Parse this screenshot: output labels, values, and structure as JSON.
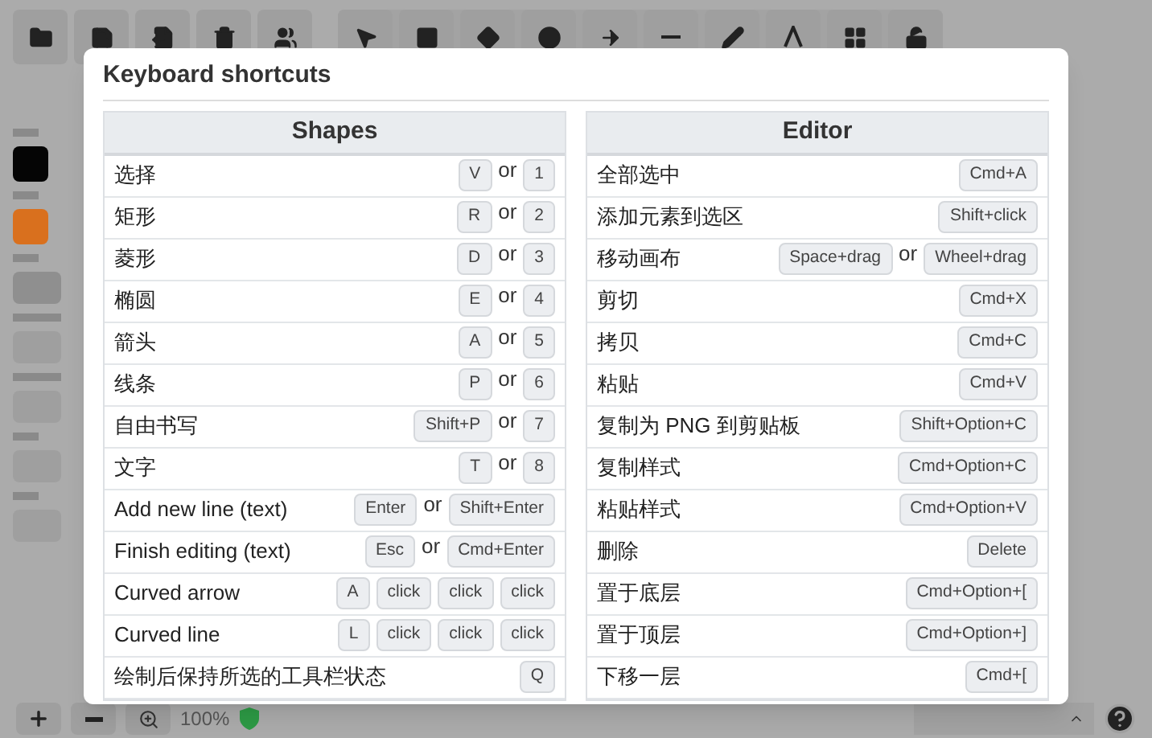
{
  "dialog": {
    "title": "Keyboard shortcuts"
  },
  "sections": [
    {
      "title": "Shapes",
      "rows": [
        {
          "label": "选择",
          "keys": [
            {
              "kind": "key",
              "text": "V"
            },
            {
              "kind": "or",
              "text": "or"
            },
            {
              "kind": "key",
              "text": "1"
            }
          ]
        },
        {
          "label": "矩形",
          "keys": [
            {
              "kind": "key",
              "text": "R"
            },
            {
              "kind": "or",
              "text": "or"
            },
            {
              "kind": "key",
              "text": "2"
            }
          ]
        },
        {
          "label": "菱形",
          "keys": [
            {
              "kind": "key",
              "text": "D"
            },
            {
              "kind": "or",
              "text": "or"
            },
            {
              "kind": "key",
              "text": "3"
            }
          ]
        },
        {
          "label": "椭圆",
          "keys": [
            {
              "kind": "key",
              "text": "E"
            },
            {
              "kind": "or",
              "text": "or"
            },
            {
              "kind": "key",
              "text": "4"
            }
          ]
        },
        {
          "label": "箭头",
          "keys": [
            {
              "kind": "key",
              "text": "A"
            },
            {
              "kind": "or",
              "text": "or"
            },
            {
              "kind": "key",
              "text": "5"
            }
          ]
        },
        {
          "label": "线条",
          "keys": [
            {
              "kind": "key",
              "text": "P"
            },
            {
              "kind": "or",
              "text": "or"
            },
            {
              "kind": "key",
              "text": "6"
            }
          ]
        },
        {
          "label": "自由书写",
          "keys": [
            {
              "kind": "key",
              "text": "Shift+P"
            },
            {
              "kind": "or",
              "text": "or"
            },
            {
              "kind": "key",
              "text": "7"
            }
          ]
        },
        {
          "label": "文字",
          "keys": [
            {
              "kind": "key",
              "text": "T"
            },
            {
              "kind": "or",
              "text": "or"
            },
            {
              "kind": "key",
              "text": "8"
            }
          ]
        },
        {
          "label": "Add new line (text)",
          "keys": [
            {
              "kind": "key",
              "text": "Enter"
            },
            {
              "kind": "or",
              "text": "or"
            },
            {
              "kind": "key",
              "text": "Shift+Enter"
            }
          ]
        },
        {
          "label": "Finish editing (text)",
          "keys": [
            {
              "kind": "key",
              "text": "Esc"
            },
            {
              "kind": "or",
              "text": "or"
            },
            {
              "kind": "key",
              "text": "Cmd+Enter"
            }
          ]
        },
        {
          "label": "Curved arrow",
          "keys": [
            {
              "kind": "key",
              "text": "A"
            },
            {
              "kind": "key",
              "text": "click"
            },
            {
              "kind": "key",
              "text": "click"
            },
            {
              "kind": "key",
              "text": "click"
            }
          ]
        },
        {
          "label": "Curved line",
          "keys": [
            {
              "kind": "key",
              "text": "L"
            },
            {
              "kind": "key",
              "text": "click"
            },
            {
              "kind": "key",
              "text": "click"
            },
            {
              "kind": "key",
              "text": "click"
            }
          ]
        },
        {
          "label": "绘制后保持所选的工具栏状态",
          "keys": [
            {
              "kind": "key",
              "text": "Q"
            }
          ]
        }
      ]
    },
    {
      "title": "Editor",
      "rows": [
        {
          "label": "全部选中",
          "keys": [
            {
              "kind": "key",
              "text": "Cmd+A"
            }
          ]
        },
        {
          "label": "添加元素到选区",
          "keys": [
            {
              "kind": "key",
              "text": "Shift+click"
            }
          ]
        },
        {
          "label": "移动画布",
          "keys": [
            {
              "kind": "key",
              "text": "Space+drag"
            },
            {
              "kind": "or",
              "text": "or"
            },
            {
              "kind": "key",
              "text": "Wheel+drag"
            }
          ]
        },
        {
          "label": "剪切",
          "keys": [
            {
              "kind": "key",
              "text": "Cmd+X"
            }
          ]
        },
        {
          "label": "拷贝",
          "keys": [
            {
              "kind": "key",
              "text": "Cmd+C"
            }
          ]
        },
        {
          "label": "粘贴",
          "keys": [
            {
              "kind": "key",
              "text": "Cmd+V"
            }
          ]
        },
        {
          "label": "复制为 PNG 到剪贴板",
          "keys": [
            {
              "kind": "key",
              "text": "Shift+Option+C"
            }
          ]
        },
        {
          "label": "复制样式",
          "keys": [
            {
              "kind": "key",
              "text": "Cmd+Option+C"
            }
          ]
        },
        {
          "label": "粘贴样式",
          "keys": [
            {
              "kind": "key",
              "text": "Cmd+Option+V"
            }
          ]
        },
        {
          "label": "删除",
          "keys": [
            {
              "kind": "key",
              "text": "Delete"
            }
          ]
        },
        {
          "label": "置于底层",
          "keys": [
            {
              "kind": "key",
              "text": "Cmd+Option+["
            }
          ]
        },
        {
          "label": "置于顶层",
          "keys": [
            {
              "kind": "key",
              "text": "Cmd+Option+]"
            }
          ]
        },
        {
          "label": "下移一层",
          "keys": [
            {
              "kind": "key",
              "text": "Cmd+["
            }
          ]
        }
      ]
    }
  ],
  "background": {
    "zoom_level": "100%"
  }
}
